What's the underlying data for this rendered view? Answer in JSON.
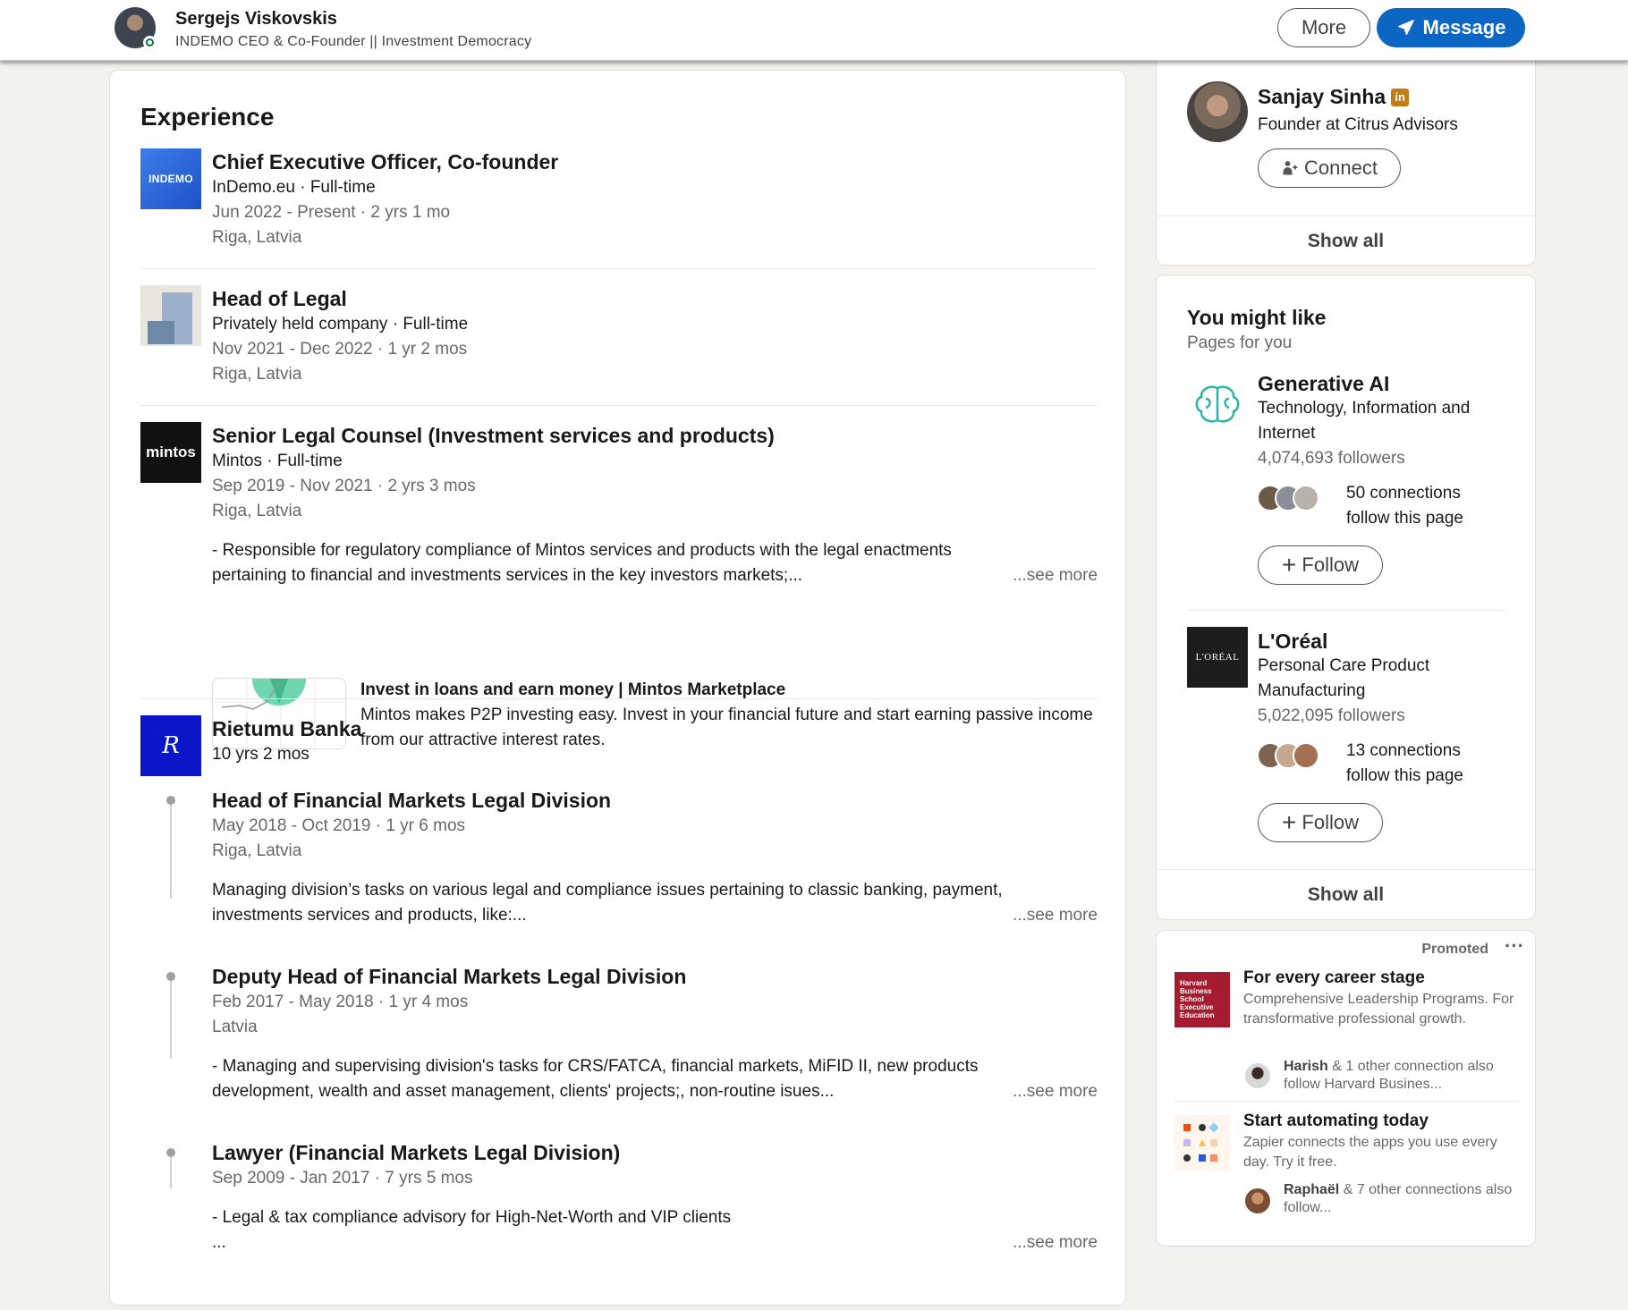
{
  "header": {
    "name": "Sergejs Viskovskis",
    "headline": "INDEMO CEO & Co-Founder || Investment Democracy",
    "more_label": "More",
    "message_label": "Message"
  },
  "experience": {
    "title": "Experience",
    "items": [
      {
        "logo_text": "INDEMO",
        "title": "Chief Executive Officer, Co-founder",
        "company": "InDemo.eu · Full-time",
        "dates": "Jun 2022 - Present · 2 yrs 1 mo",
        "location": "Riga, Latvia"
      },
      {
        "title": "Head of Legal",
        "company": "Privately held company · Full-time",
        "dates": "Nov 2021 - Dec 2022 · 1 yr 2 mos",
        "location": "Riga, Latvia"
      },
      {
        "logo_text": "mintos",
        "title": "Senior Legal Counsel (Investment services and products)",
        "company": "Mintos · Full-time",
        "dates": "Sep 2019 - Nov 2021 · 2 yrs 3 mos",
        "location": "Riga, Latvia",
        "description": "- Responsible for regulatory compliance of Mintos services and products with the legal enactments pertaining to financial and investments services in the key investors markets;...",
        "see_more": "...see more",
        "media_title": "Invest in loans and earn money | Mintos Marketplace",
        "media_desc": "Mintos makes P2P investing easy. Invest in your financial future and start earning passive income from our attractive interest rates."
      }
    ],
    "group": {
      "logo_text": "R",
      "company": "Rietumu Banka",
      "duration": "10 yrs 2 mos",
      "roles": [
        {
          "title": "Head of Financial Markets Legal Division",
          "dates": "May 2018 - Oct 2019 · 1 yr 6 mos",
          "location": "Riga, Latvia",
          "description": "Managing division’s tasks on various legal and compliance issues pertaining to classic banking, payment, investments services and products, like:...",
          "see_more": "...see more"
        },
        {
          "title": "Deputy Head of Financial Markets Legal Division",
          "dates": "Feb 2017 - May 2018 · 1 yr 4 mos",
          "location": "Latvia",
          "description": "- Managing and supervising division's tasks for CRS/FATCA, financial markets, MiFID II, new products development, wealth and asset management, clients' projects;, non-routine isues...",
          "see_more": "...see more"
        },
        {
          "title": "Lawyer (Financial Markets Legal Division)",
          "dates": "Sep 2009 - Jan 2017 · 7 yrs 5 mos",
          "description_line1": "- Legal & tax compliance advisory for High-Net-Worth and VIP clients",
          "description_line2": "...",
          "see_more": "...see more"
        }
      ]
    }
  },
  "people_card": {
    "name": "Sanjay Sinha",
    "linkedin_badge": "in",
    "headline": "Founder at Citrus Advisors",
    "connect_label": "Connect",
    "show_all": "Show all"
  },
  "you_might_like": {
    "title": "You might like",
    "subtitle": "Pages for you",
    "pages": [
      {
        "name": "Generative AI",
        "industry": "Technology, Information and Internet",
        "followers": "4,074,693 followers",
        "connections": "50 connections follow this page",
        "follow_label": "Follow"
      },
      {
        "logo_text": "L'ORÉAL",
        "name": "L'Oréal",
        "industry": "Personal Care Product Manufacturing",
        "followers": "5,022,095 followers",
        "connections": "13 connections follow this page",
        "follow_label": "Follow"
      }
    ],
    "show_all": "Show all"
  },
  "promoted": {
    "label": "Promoted",
    "ads": [
      {
        "logo_text": "Harvard Business School Executive Education",
        "title": "For every career stage",
        "text": "Comprehensive Leadership Programs. For transformative professional growth.",
        "social_name": "Harish",
        "social_rest": " & 1 other connection also follow Harvard Busines..."
      },
      {
        "title": "Start automating today",
        "text": "Zapier connects the apps you use every day. Try it free.",
        "social_name": "Raphaël",
        "social_rest": " & 7 other connections also follow..."
      }
    ]
  },
  "colors": {
    "primary_blue": "#0a66c2",
    "page_bg": "#f4f2ee",
    "online_green": "#057642"
  }
}
